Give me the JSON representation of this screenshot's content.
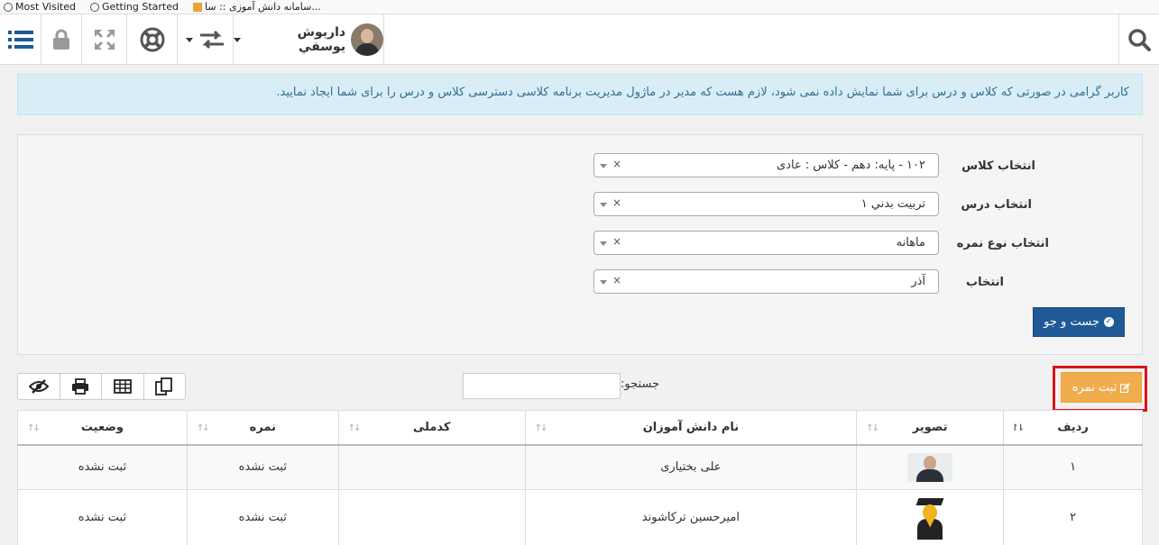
{
  "bookmarks": [
    {
      "label": "Most Visited",
      "icon": "gear-icon"
    },
    {
      "label": "Getting Started",
      "icon": "globe-icon"
    },
    {
      "label": "سامانه دانش آموزی :: سا...",
      "icon": "bookmark-icon"
    }
  ],
  "topbar": {
    "user_name": "داريوش يوسفي",
    "icons": [
      "search-icon",
      "transfer-icon",
      "lifebuoy-icon",
      "fullscreen-icon",
      "lock-icon",
      "menu-icon"
    ]
  },
  "alert": {
    "text": "کاربر گرامی در صورتی که کلاس و درس برای شما نمایش داده نمی شود، لازم هست که مدیر در ماژول مدیریت برنامه کلاسی دسترسی کلاس و درس را برای شما ایجاد نمایید."
  },
  "filters": {
    "class_label": "انتخاب کلاس",
    "class_value": "۱۰۲ - پایه: دهم - کلاس : عادی",
    "lesson_label": "انتخاب درس",
    "lesson_value": "تربيت بدني ۱",
    "grade_type_label": "انتخاب نوع نمره",
    "grade_type_value": "ماهانه",
    "select_label": "انتخاب",
    "select_value": "آذر",
    "clear_symbol": "×",
    "search_button": "جست و جو"
  },
  "toolbar": {
    "register_button": "ثبت نمره",
    "search_label": "جستجو:",
    "search_value": ""
  },
  "table": {
    "headers": {
      "row": "رديف",
      "photo": "تصوير",
      "student_name": "نام دانش آموزان",
      "national_code": "کدملی",
      "grade": "نمره",
      "status": "وضعيت"
    },
    "rows": [
      {
        "index": "۱",
        "name": "علی بختیاری",
        "national_code": "",
        "grade": "ثبت نشده",
        "status": "ثبت نشده"
      },
      {
        "index": "۲",
        "name": "امیرحسین ترکاشوند",
        "national_code": "",
        "grade": "ثبت نشده",
        "status": "ثبت نشده"
      }
    ]
  },
  "colors": {
    "primary": "#1f5a96",
    "warning": "#f0ad4e",
    "highlight": "#d9141b",
    "info_bg": "#d9edf7"
  }
}
